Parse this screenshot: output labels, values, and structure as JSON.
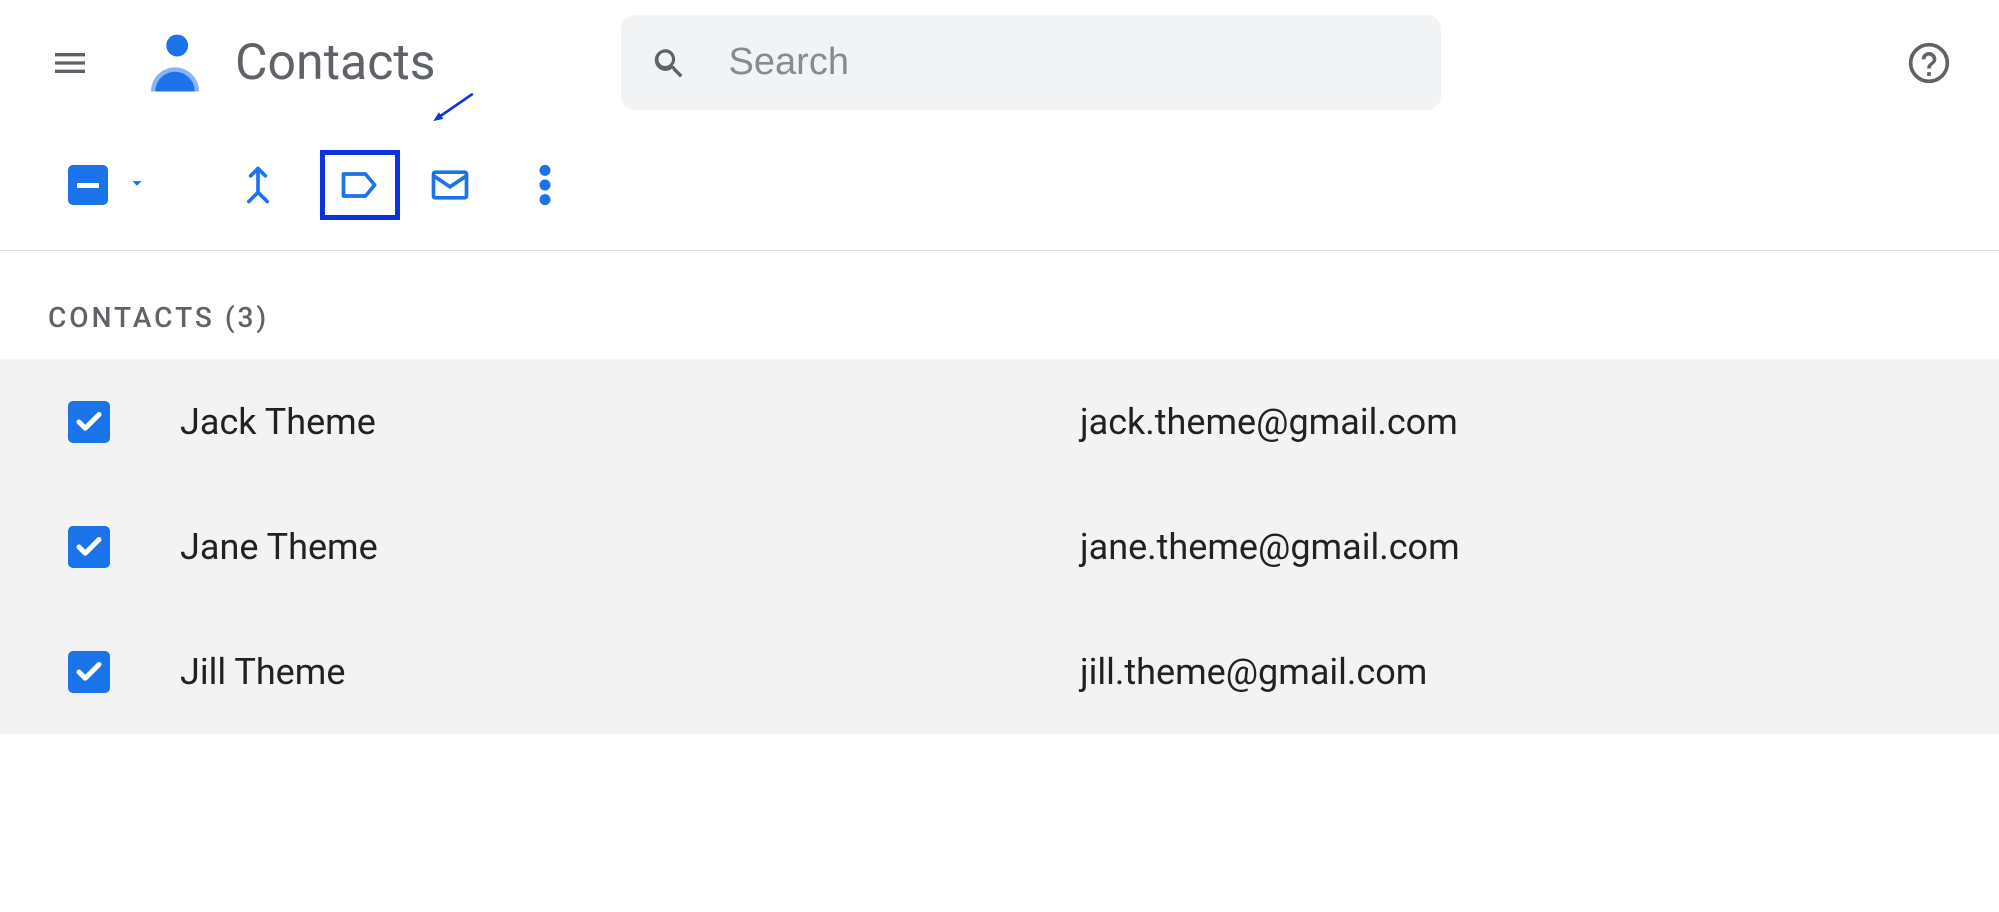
{
  "header": {
    "app_title": "Contacts",
    "search_placeholder": "Search"
  },
  "section": {
    "label": "CONTACTS (3)"
  },
  "contacts": [
    {
      "name": "Jack Theme",
      "email": "jack.theme@gmail.com"
    },
    {
      "name": "Jane Theme",
      "email": "jane.theme@gmail.com"
    },
    {
      "name": "Jill Theme",
      "email": "jill.theme@gmail.com"
    }
  ]
}
